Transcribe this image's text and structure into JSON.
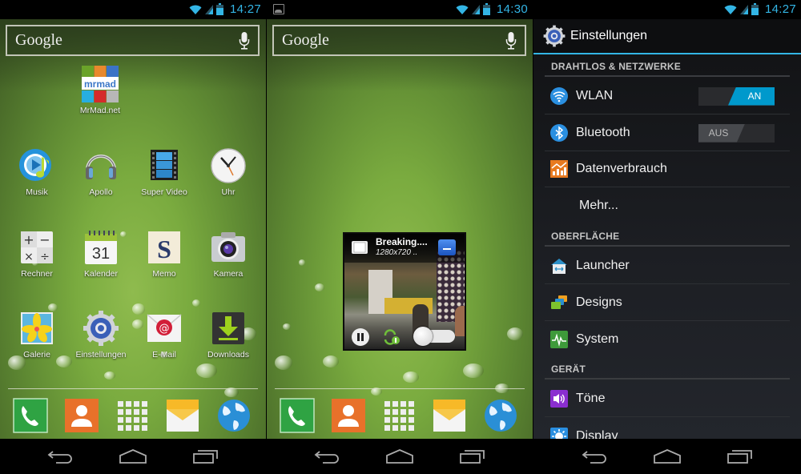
{
  "screens": [
    {
      "status": {
        "time": "14:27"
      },
      "search": {
        "logo": "Google"
      },
      "apps": [
        {
          "label": "MrMad.net",
          "icon": "mrmad-icon",
          "banner": "mrmad"
        },
        {
          "label": "Musik",
          "icon": "music-icon"
        },
        {
          "label": "Apollo",
          "icon": "headphones-icon"
        },
        {
          "label": "Super Video",
          "icon": "film-strip-icon"
        },
        {
          "label": "Uhr",
          "icon": "clock-icon"
        },
        {
          "label": "Rechner",
          "icon": "calculator-icon"
        },
        {
          "label": "Kalender",
          "icon": "calendar-icon",
          "day": "31"
        },
        {
          "label": "Memo",
          "icon": "memo-icon",
          "letter": "S"
        },
        {
          "label": "Kamera",
          "icon": "camera-icon"
        },
        {
          "label": "Galerie",
          "icon": "gallery-icon"
        },
        {
          "label": "Einstellungen",
          "icon": "settings-gear-icon"
        },
        {
          "label": "E-Mail",
          "icon": "email-icon"
        },
        {
          "label": "Downloads",
          "icon": "download-icon"
        }
      ],
      "dock": [
        "phone-icon",
        "contacts-icon",
        "app-drawer-icon",
        "messaging-icon",
        "browser-globe-icon"
      ]
    },
    {
      "status": {
        "time": "14:30",
        "notification": "gallery-notification-icon"
      },
      "search": {
        "logo": "Google"
      },
      "video_popup": {
        "title": "Breaking....",
        "resolution": "1280x720",
        "resolution_suffix": "..",
        "progress": 0.0
      },
      "dock": [
        "phone-icon",
        "contacts-icon",
        "app-drawer-icon",
        "messaging-icon",
        "browser-globe-icon"
      ]
    },
    {
      "status": {
        "time": "14:27"
      },
      "actionbar": {
        "title": "Einstellungen"
      },
      "sections": [
        {
          "title": "DRAHTLOS & NETZWERKE"
        },
        {
          "title": "OBERFLÄCHE"
        },
        {
          "title": "GERÄT"
        }
      ],
      "rows": [
        {
          "label": "WLAN",
          "icon": "wifi-icon",
          "toggle": "AN",
          "enabled": true
        },
        {
          "label": "Bluetooth",
          "icon": "bluetooth-icon",
          "toggle": "AUS",
          "enabled": false
        },
        {
          "label": "Datenverbrauch",
          "icon": "data-usage-icon"
        },
        {
          "label": "Mehr..."
        },
        {
          "label": "Launcher",
          "icon": "launcher-icon"
        },
        {
          "label": "Designs",
          "icon": "designs-icon"
        },
        {
          "label": "System",
          "icon": "system-icon"
        },
        {
          "label": "Töne",
          "icon": "sound-icon"
        },
        {
          "label": "Display",
          "icon": "display-icon"
        }
      ]
    }
  ],
  "colors": {
    "accent": "#33b5e5",
    "toggle_on": "#0099cc"
  }
}
